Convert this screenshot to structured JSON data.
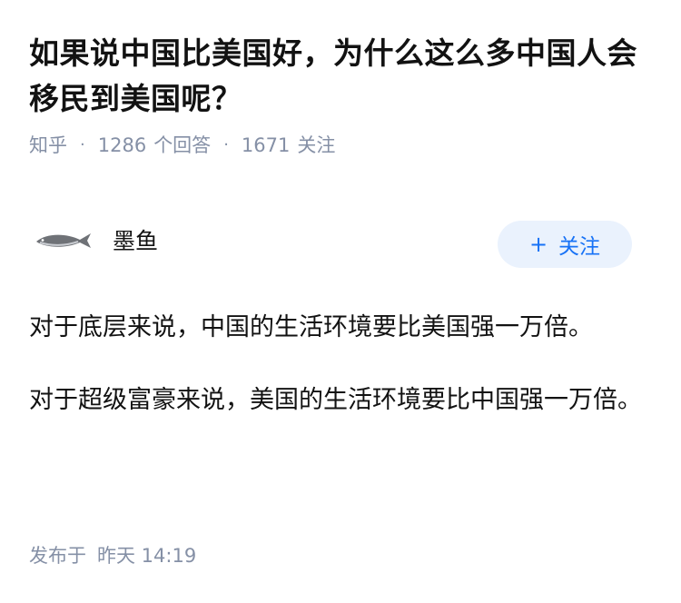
{
  "question": {
    "title": "如果说中国比美国好，为什么这么多中国人会移民到美国呢？"
  },
  "meta": {
    "source": "知乎",
    "separator": "·",
    "answer_count": "1286",
    "answer_label": "个回答",
    "follower_count": "1671",
    "follower_label": "关注"
  },
  "author": {
    "name": "墨鱼",
    "avatar_icon": "fish-icon",
    "follow_icon": "plus-icon",
    "follow_label": "关注"
  },
  "answer": {
    "paragraphs": [
      "对于底层来说，中国的生活环境要比美国强一万倍。",
      "对于超级富豪来说，美国的生活环境要比中国强一万倍。"
    ]
  },
  "publish": {
    "label": "发布于",
    "time": "昨天 14:19"
  },
  "colors": {
    "accent": "#1772f6",
    "meta_text": "#8590a6",
    "follow_bg": "#eaf2fd"
  }
}
